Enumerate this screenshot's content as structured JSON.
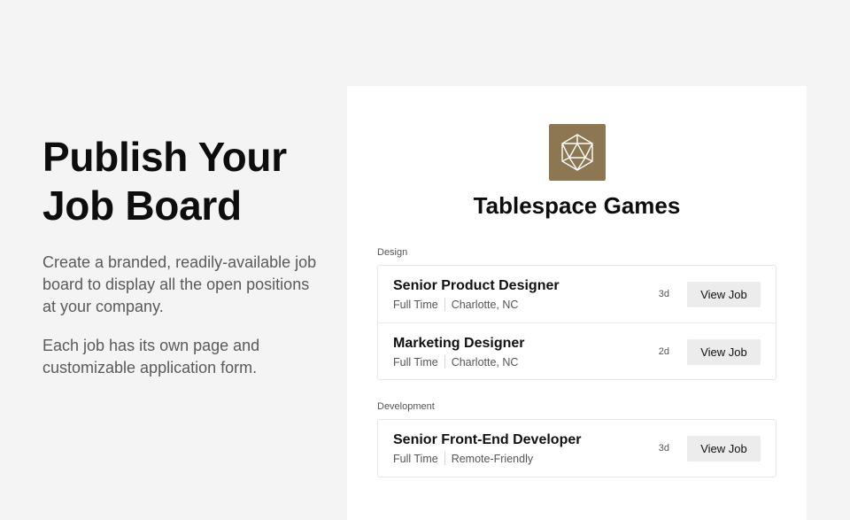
{
  "hero": {
    "headline_line1": "Publish Your",
    "headline_line2": "Job Board",
    "paragraph1": "Create a branded, readily-available job board to display all the open positions at your company.",
    "paragraph2": "Each job has its own page and customizable application form."
  },
  "board": {
    "logo_icon": "d20-dice-icon",
    "logo_color": "#8c7752",
    "company_name": "Tablespace Games",
    "sections": [
      {
        "label": "Design",
        "jobs": [
          {
            "title": "Senior Product Designer",
            "type": "Full Time",
            "location": "Charlotte, NC",
            "age": "3d",
            "button": "View Job"
          },
          {
            "title": "Marketing Designer",
            "type": "Full Time",
            "location": "Charlotte, NC",
            "age": "2d",
            "button": "View Job"
          }
        ]
      },
      {
        "label": "Development",
        "jobs": [
          {
            "title": "Senior Front-End Developer",
            "type": "Full Time",
            "location": "Remote-Friendly",
            "age": "3d",
            "button": "View Job"
          }
        ]
      }
    ]
  }
}
